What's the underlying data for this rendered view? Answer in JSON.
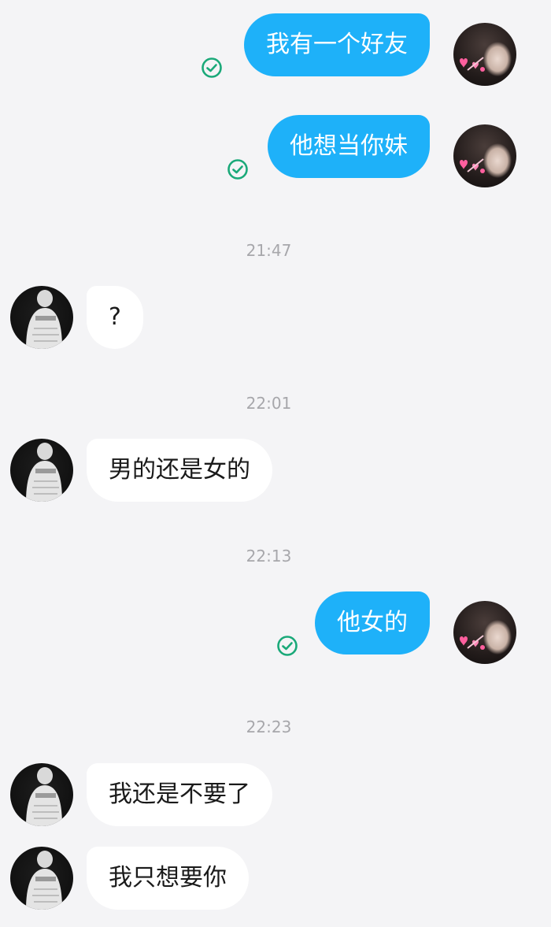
{
  "conversation": {
    "messages": [
      {
        "id": "m1",
        "direction": "outgoing",
        "text": "我有一个好友",
        "status": "sent"
      },
      {
        "id": "m2",
        "direction": "outgoing",
        "text": "他想当你妹",
        "status": "sent"
      },
      {
        "id": "t1",
        "type": "timestamp",
        "text": "21:47"
      },
      {
        "id": "m3",
        "direction": "incoming",
        "text": "?"
      },
      {
        "id": "t2",
        "type": "timestamp",
        "text": "22:01"
      },
      {
        "id": "m4",
        "direction": "incoming",
        "text": "男的还是女的"
      },
      {
        "id": "t3",
        "type": "timestamp",
        "text": "22:13"
      },
      {
        "id": "m5",
        "direction": "outgoing",
        "text": "他女的",
        "status": "sent"
      },
      {
        "id": "t4",
        "type": "timestamp",
        "text": "22:23"
      },
      {
        "id": "m6",
        "direction": "incoming",
        "text": "我还是不要了"
      },
      {
        "id": "m7",
        "direction": "incoming",
        "text": "我只想要你"
      }
    ]
  },
  "theme": {
    "background": "#f4f4f6",
    "outgoing_bubble": "#1eb1f9",
    "incoming_bubble": "#ffffff",
    "sent_check_color": "#1aa979",
    "timestamp_color": "#a7a7ab"
  },
  "icons": {
    "sent_status": "check-circle-icon",
    "my_avatar": "avatar-photo",
    "contact_avatar": "avatar-photo"
  }
}
